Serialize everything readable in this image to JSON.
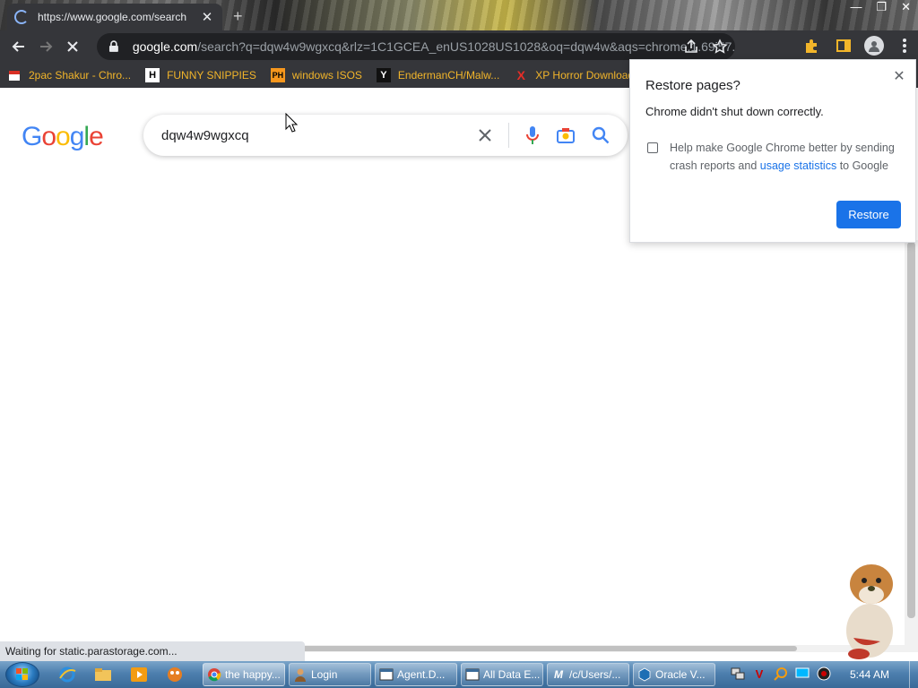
{
  "browser": {
    "tab": {
      "title": "https://www.google.com/search",
      "close": "✕"
    },
    "new_tab": "+",
    "window_controls": {
      "minimize": "—",
      "restore": "❐",
      "close": "✕"
    },
    "url": {
      "host": "google.com",
      "path": "/search?q=dqw4w9wgxcq&rlz=1C1GCEA_enUS1028US1028&oq=dqw4w&aqs=chrome.1.69i57..."
    },
    "bookmarks": [
      {
        "label": "2pac Shakur - Chro...",
        "icon": "calendar-icon"
      },
      {
        "label": "FUNNY SNIPPIES",
        "icon": "H",
        "icon_name": "h-logo-icon"
      },
      {
        "label": "windows ISOS",
        "icon": "PH",
        "icon_name": "ph-logo-icon"
      },
      {
        "label": "EndermanCH/Malw...",
        "icon": "Y",
        "icon_name": "yt-logo-icon"
      },
      {
        "label": "XP Horror Download",
        "icon": "X",
        "icon_name": "x-logo-icon"
      }
    ]
  },
  "page": {
    "logo": [
      "G",
      "o",
      "o",
      "g",
      "l",
      "e"
    ],
    "logo_colors": [
      "#4285F4",
      "#EA4335",
      "#FBBC05",
      "#4285F4",
      "#34A853",
      "#EA4335"
    ],
    "search": {
      "query": "dqw4w9wgxcq"
    }
  },
  "popup": {
    "title": "Restore pages?",
    "message": "Chrome didn't shut down correctly.",
    "help_pre": "Help make Google Chrome better by sending crash reports and ",
    "help_link": "usage statistics",
    "help_post": " to Google",
    "restore_label": "Restore",
    "close": "✕"
  },
  "status": "Waiting for static.parastorage.com...",
  "taskbar": {
    "tasks": [
      {
        "label": "the happy...",
        "icon": "chrome-icon",
        "active": true
      },
      {
        "label": "Login",
        "icon": "user-icon"
      },
      {
        "label": "Agent.D...",
        "icon": "window-icon"
      },
      {
        "label": "All Data E...",
        "icon": "window-icon"
      },
      {
        "label": "/c/Users/...",
        "icon": "m-logo-icon"
      },
      {
        "label": "Oracle V...",
        "icon": "virtualbox-icon"
      }
    ],
    "clock": "5:44 AM"
  },
  "colors": {
    "chrome_dark": "#35363a",
    "bookmark_text": "#f2b52a",
    "accent": "#1a73e8"
  }
}
